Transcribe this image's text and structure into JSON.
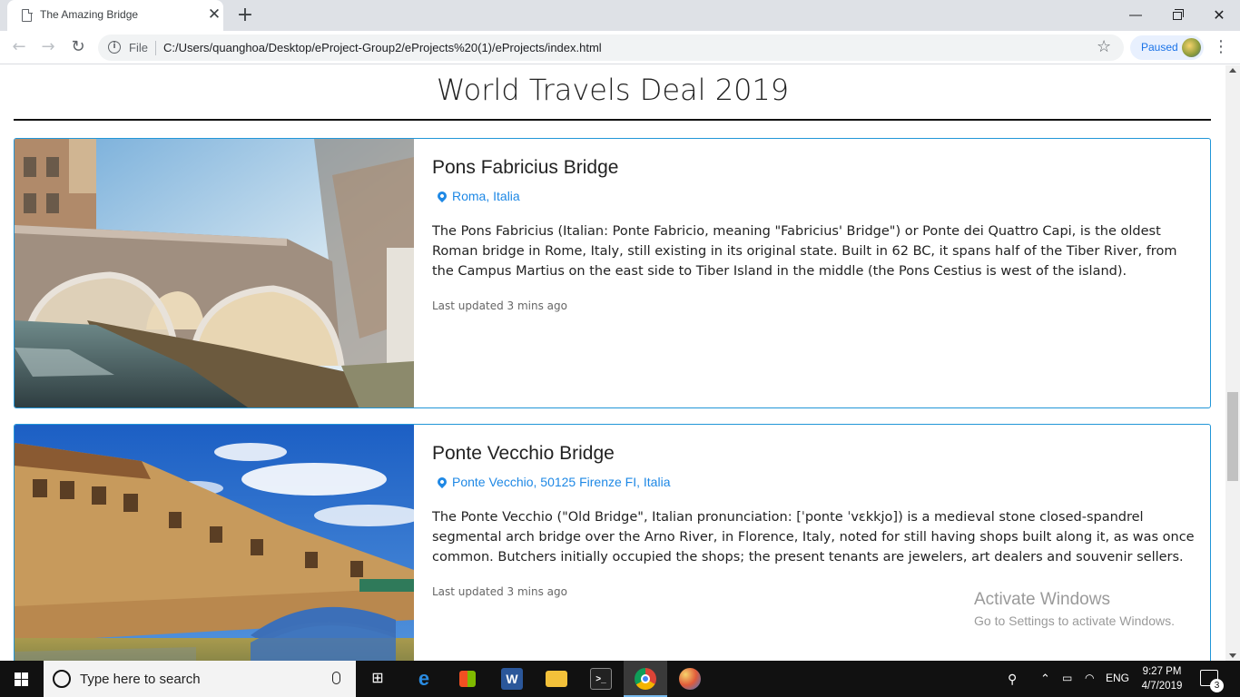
{
  "browser": {
    "tab_title": "The Amazing Bridge",
    "tab_close": "✕",
    "new_tab": "+",
    "url_scheme": "File",
    "url": "C:/Users/quanghoa/Desktop/eProject-Group2/eProjects%20(1)/eProjects/index.html",
    "profile_status": "Paused"
  },
  "page": {
    "heading": "World Travels Deal 2019",
    "cards": [
      {
        "title": "Pons Fabricius Bridge",
        "location": "Roma, Italia",
        "description": "The Pons Fabricius (Italian: Ponte Fabricio, meaning \"Fabricius' Bridge\") or Ponte dei Quattro Capi, is the oldest Roman bridge in Rome, Italy, still existing in its original state. Built in 62 BC, it spans half of the Tiber River, from the Campus Martius on the east side to Tiber Island in the middle (the Pons Cestius is west of the island).",
        "updated": "Last updated 3 mins ago"
      },
      {
        "title": "Ponte Vecchio Bridge",
        "location": "Ponte Vecchio, 50125 Firenze FI, Italia",
        "description": "The Ponte Vecchio (\"Old Bridge\", Italian pronunciation: [ˈponte ˈvɛkkjo]) is a medieval stone closed-spandrel segmental arch bridge over the Arno River, in Florence, Italy, noted for still having shops built along it, as was once common. Butchers initially occupied the shops; the present tenants are jewelers, art dealers and souvenir sellers.",
        "updated": "Last updated 3 mins ago"
      }
    ]
  },
  "watermark": {
    "title": "Activate Windows",
    "subtitle": "Go to Settings to activate Windows."
  },
  "taskbar": {
    "search_placeholder": "Type here to search",
    "language": "ENG",
    "time": "9:27 PM",
    "date": "4/7/2019",
    "notification_count": "3"
  },
  "colors": {
    "accent": "#2196d8",
    "link": "#1e88e5"
  }
}
